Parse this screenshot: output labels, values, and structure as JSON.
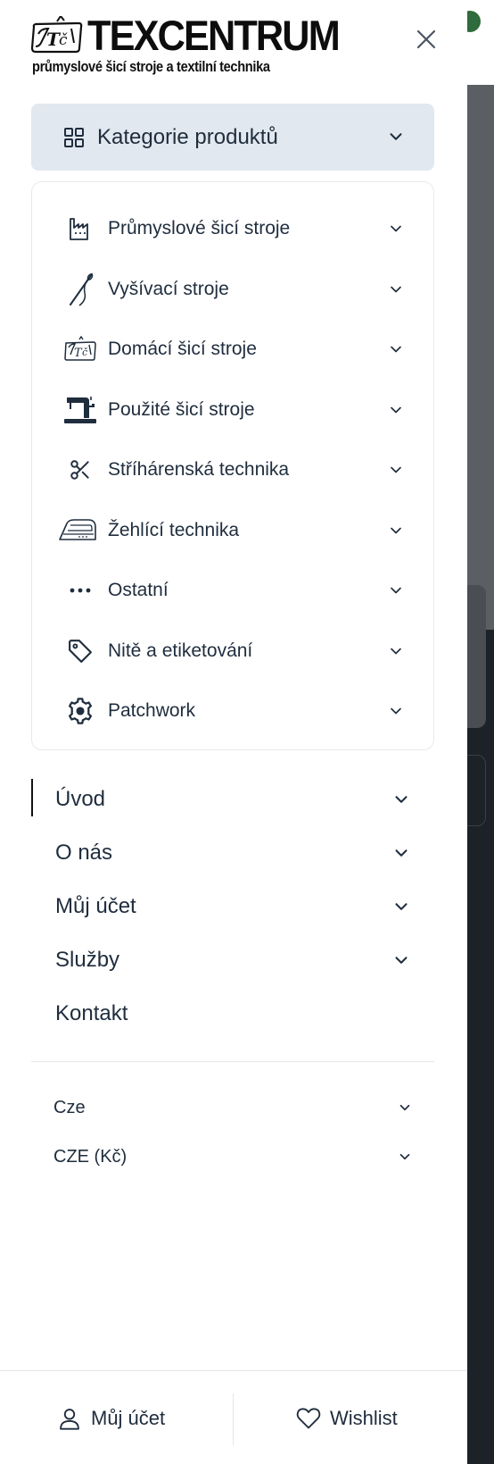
{
  "brand": {
    "name": "TEXCENTRUM",
    "tagline": "průmyslové šicí stroje a textilní technika"
  },
  "drawer": {
    "close_icon": "close-icon",
    "categories_toggle": {
      "label": "Kategorie produktů",
      "icon": "grid-icon",
      "expanded": true
    },
    "categories": [
      {
        "label": "Průmyslové šicí stroje",
        "icon": "factory-icon"
      },
      {
        "label": "Vyšívací stroje",
        "icon": "needle-icon"
      },
      {
        "label": "Domácí šicí stroje",
        "icon": "home-sewing-machine-icon"
      },
      {
        "label": "Použité šicí stroje",
        "icon": "sewing-machine-icon"
      },
      {
        "label": "Stříhárenská technika",
        "icon": "scissors-icon"
      },
      {
        "label": "Žehlící technika",
        "icon": "iron-icon"
      },
      {
        "label": "Ostatní",
        "icon": "more-dots-icon"
      },
      {
        "label": "Nitě a etiketování",
        "icon": "tag-icon"
      },
      {
        "label": "Patchwork",
        "icon": "gear-icon"
      }
    ],
    "menu": [
      {
        "label": "Úvod",
        "has_submenu": true,
        "active": true
      },
      {
        "label": "O nás",
        "has_submenu": true
      },
      {
        "label": "Můj účet",
        "has_submenu": true
      },
      {
        "label": "Služby",
        "has_submenu": true
      },
      {
        "label": "Kontakt",
        "has_submenu": false
      }
    ],
    "language": {
      "value": "Cze"
    },
    "currency": {
      "value": "CZE (Kč)"
    },
    "footer": {
      "account_label": "Můj účet",
      "wishlist_label": "Wishlist"
    }
  },
  "colors": {
    "toggle_bg": "#e2e8ef",
    "text": "#1f2d3d",
    "backdrop": "#1c2227"
  }
}
